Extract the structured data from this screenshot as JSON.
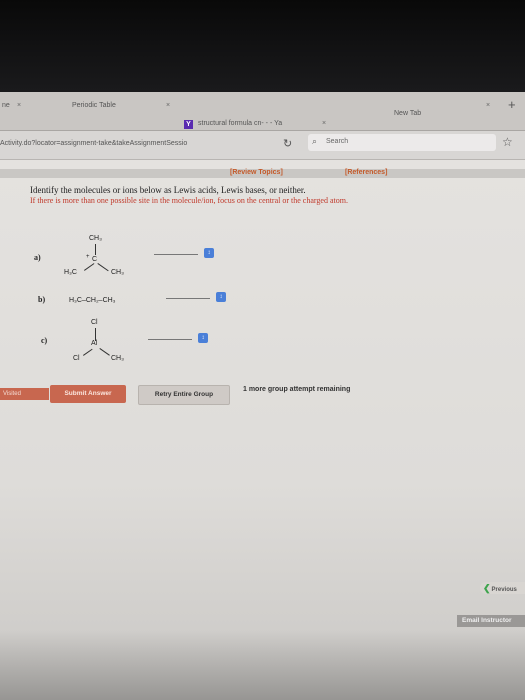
{
  "browser": {
    "tabs": [
      {
        "label": "ne",
        "close": "×"
      },
      {
        "label": "Periodic Table",
        "close": "×"
      },
      {
        "label": "structural formula cn- - - Ya",
        "close": "×",
        "icon": "Y"
      },
      {
        "label": "New Tab",
        "close": "×"
      }
    ],
    "new_tab": "+",
    "url": "Activity.do?locator=assignment-take&takeAssignmentSessio",
    "search_placeholder": "Search"
  },
  "page": {
    "review_topics": "[Review Topics]",
    "references": "[References]",
    "prompt": "Identify the molecules or ions below as Lewis acids, Lewis bases, or neither.",
    "instruction": "If there is more than one possible site in the molecule/ion, focus on the central or the charged atom.",
    "questions": [
      {
        "label": "a)",
        "atoms": {
          "top": "CH₃",
          "center": "C",
          "charge": "+",
          "left": "H₃C",
          "right": "CH₃"
        }
      },
      {
        "label": "b)",
        "formula": "H₃C–CH₂–CH₃"
      },
      {
        "label": "c)",
        "atoms": {
          "top": "Cl",
          "center": "Al",
          "left": "Cl",
          "right": "CH₃"
        }
      }
    ],
    "visited": "Visited",
    "submit": "Submit Answer",
    "retry": "Retry Entire Group",
    "attempts": "1 more group attempt remaining",
    "previous": "Previous",
    "email": "Email Instructor"
  },
  "colors": {
    "accent": "#c45a2a",
    "error": "#c0392b",
    "select_arrow": "#4a7fd8"
  }
}
